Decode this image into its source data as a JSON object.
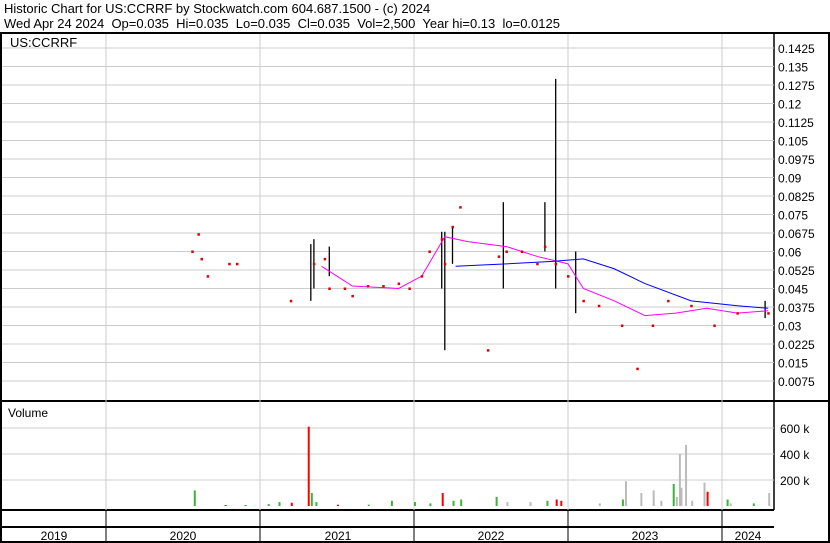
{
  "header": {
    "title": "Historic Chart for US:CCRRF by Stockwatch.com 604.687.1500 - (c) 2024",
    "quote": "Wed Apr 24 2024  Op=0.035  Hi=0.035  Lo=0.035  Cl=0.035  Vol=2,500  Year hi=0.13  lo=0.0125"
  },
  "chart_data": [
    {
      "type": "line",
      "title": "US:CCRRF",
      "ylim": [
        0,
        0.15
      ],
      "yticks": [
        "0.1425",
        "0.135",
        "0.1275",
        "0.12",
        "0.1125",
        "0.105",
        "0.0975",
        "0.09",
        "0.0825",
        "0.075",
        "0.0675",
        "0.06",
        "0.0525",
        "0.045",
        "0.0375",
        "0.03",
        "0.0225",
        "0.015",
        "0.0075"
      ],
      "x_unit": "year",
      "closes": [
        [
          2020.56,
          0.06
        ],
        [
          2020.6,
          0.067
        ],
        [
          2020.62,
          0.057
        ],
        [
          2020.66,
          0.05
        ],
        [
          2020.8,
          0.055
        ],
        [
          2020.85,
          0.055
        ],
        [
          2021.2,
          0.04
        ],
        [
          2021.35,
          0.055
        ],
        [
          2021.42,
          0.057
        ],
        [
          2021.45,
          0.045
        ],
        [
          2021.55,
          0.045
        ],
        [
          2021.6,
          0.042
        ],
        [
          2021.7,
          0.046
        ],
        [
          2021.8,
          0.046
        ],
        [
          2021.9,
          0.047
        ],
        [
          2021.97,
          0.045
        ],
        [
          2022.05,
          0.05
        ],
        [
          2022.1,
          0.06
        ],
        [
          2022.18,
          0.065
        ],
        [
          2022.2,
          0.055
        ],
        [
          2022.25,
          0.07
        ],
        [
          2022.3,
          0.078
        ],
        [
          2022.48,
          0.02
        ],
        [
          2022.55,
          0.058
        ],
        [
          2022.6,
          0.06
        ],
        [
          2022.7,
          0.06
        ],
        [
          2022.8,
          0.055
        ],
        [
          2022.85,
          0.062
        ],
        [
          2022.92,
          0.055
        ],
        [
          2023.0,
          0.05
        ],
        [
          2023.1,
          0.04
        ],
        [
          2023.2,
          0.038
        ],
        [
          2023.35,
          0.03
        ],
        [
          2023.45,
          0.0125
        ],
        [
          2023.55,
          0.03
        ],
        [
          2023.65,
          0.04
        ],
        [
          2023.8,
          0.038
        ],
        [
          2023.95,
          0.03
        ],
        [
          2024.1,
          0.035
        ],
        [
          2024.3,
          0.035
        ]
      ],
      "ranges": [
        [
          2021.33,
          0.04,
          0.063
        ],
        [
          2021.35,
          0.045,
          0.065
        ],
        [
          2021.45,
          0.05,
          0.062
        ],
        [
          2022.18,
          0.045,
          0.068
        ],
        [
          2022.2,
          0.02,
          0.068
        ],
        [
          2022.25,
          0.055,
          0.07
        ],
        [
          2022.58,
          0.045,
          0.08
        ],
        [
          2022.85,
          0.06,
          0.08
        ],
        [
          2022.92,
          0.045,
          0.13
        ],
        [
          2023.05,
          0.035,
          0.06
        ],
        [
          2024.28,
          0.033,
          0.04
        ]
      ],
      "series": [
        {
          "name": "MA short",
          "color": "#ff00ff",
          "points": [
            [
              2021.4,
              0.054
            ],
            [
              2021.6,
              0.046
            ],
            [
              2021.9,
              0.045
            ],
            [
              2022.05,
              0.05
            ],
            [
              2022.2,
              0.066
            ],
            [
              2022.35,
              0.064
            ],
            [
              2022.6,
              0.062
            ],
            [
              2022.8,
              0.058
            ],
            [
              2023.0,
              0.055
            ],
            [
              2023.1,
              0.045
            ],
            [
              2023.3,
              0.04
            ],
            [
              2023.5,
              0.034
            ],
            [
              2023.7,
              0.035
            ],
            [
              2023.9,
              0.037
            ],
            [
              2024.1,
              0.035
            ],
            [
              2024.3,
              0.036
            ]
          ]
        },
        {
          "name": "MA long",
          "color": "#0000ff",
          "points": [
            [
              2022.27,
              0.054
            ],
            [
              2022.6,
              0.055
            ],
            [
              2022.9,
              0.056
            ],
            [
              2023.1,
              0.057
            ],
            [
              2023.3,
              0.053
            ],
            [
              2023.5,
              0.047
            ],
            [
              2023.8,
              0.04
            ],
            [
              2024.1,
              0.038
            ],
            [
              2024.3,
              0.037
            ]
          ]
        }
      ]
    },
    {
      "type": "bar",
      "title": "Volume",
      "yticks": [
        "600 k",
        "400 k",
        "200 k"
      ],
      "ylim": [
        0,
        760000
      ],
      "bars": [
        [
          2020.57,
          120000,
          "#3cb43c"
        ],
        [
          2020.77,
          8000,
          "#ff0000"
        ],
        [
          2020.9,
          6000,
          "#ff0000"
        ],
        [
          2021.05,
          15000,
          "#3cb43c"
        ],
        [
          2021.12,
          30000,
          "#3cb43c"
        ],
        [
          2021.2,
          25000,
          "#ff0000"
        ],
        [
          2021.31,
          610000,
          "#ff0000"
        ],
        [
          2021.33,
          100000,
          "#3cb43c"
        ],
        [
          2021.36,
          30000,
          "#3cb43c"
        ],
        [
          2021.5,
          10000,
          "#ff0000"
        ],
        [
          2021.7,
          10000,
          "#3cb43c"
        ],
        [
          2021.85,
          40000,
          "#3cb43c"
        ],
        [
          2022.0,
          30000,
          "#3cb43c"
        ],
        [
          2022.1,
          20000,
          "#3cb43c"
        ],
        [
          2022.18,
          100000,
          "#ff0000"
        ],
        [
          2022.25,
          40000,
          "#3cb43c"
        ],
        [
          2022.3,
          50000,
          "#3cb43c"
        ],
        [
          2022.53,
          70000,
          "#3cb43c"
        ],
        [
          2022.6,
          30000,
          "#bbbbbb"
        ],
        [
          2022.75,
          30000,
          "#bbbbbb"
        ],
        [
          2022.86,
          40000,
          "#3cb43c"
        ],
        [
          2022.92,
          50000,
          "#ff0000"
        ],
        [
          2022.95,
          40000,
          "#ff0000"
        ],
        [
          2023.2,
          20000,
          "#bbbbbb"
        ],
        [
          2023.35,
          50000,
          "#3cb43c"
        ],
        [
          2023.37,
          190000,
          "#bbbbbb"
        ],
        [
          2023.47,
          100000,
          "#bbbbbb"
        ],
        [
          2023.55,
          120000,
          "#bbbbbb"
        ],
        [
          2023.6,
          40000,
          "#bbbbbb"
        ],
        [
          2023.68,
          170000,
          "#3cb43c"
        ],
        [
          2023.7,
          70000,
          "#bbbbbb"
        ],
        [
          2023.72,
          400000,
          "#bbbbbb"
        ],
        [
          2023.73,
          140000,
          "#bbbbbb"
        ],
        [
          2023.76,
          470000,
          "#bbbbbb"
        ],
        [
          2023.8,
          40000,
          "#bbbbbb"
        ],
        [
          2023.88,
          180000,
          "#bbbbbb"
        ],
        [
          2023.9,
          110000,
          "#ff0000"
        ],
        [
          2024.03,
          50000,
          "#3cb43c"
        ],
        [
          2024.05,
          20000,
          "#bbbbbb"
        ],
        [
          2024.2,
          20000,
          "#3cb43c"
        ],
        [
          2024.3,
          100000,
          "#bbbbbb"
        ]
      ]
    }
  ],
  "xaxis": {
    "years": [
      "2019",
      "2020",
      "2021",
      "2022",
      "2023",
      "2024"
    ]
  }
}
